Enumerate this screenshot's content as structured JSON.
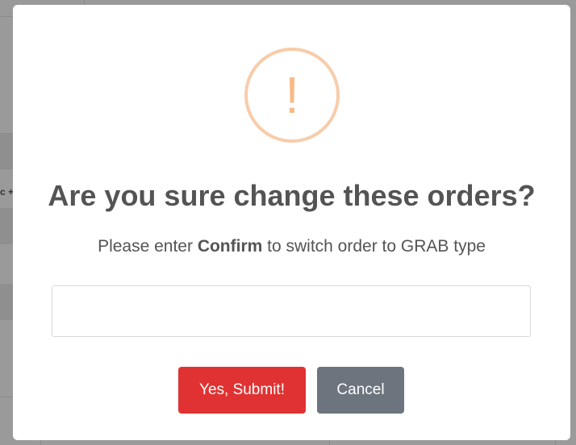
{
  "background": {
    "partial_text": "c +"
  },
  "dialog": {
    "icon": "warning-exclamation-icon",
    "icon_glyph": "!",
    "icon_color": "#f8bb86",
    "title": "Are you sure change these orders?",
    "message_prefix": "Please enter ",
    "message_keyword": "Confirm",
    "message_suffix": " to switch order to GRAB type",
    "input": {
      "value": "",
      "placeholder": ""
    },
    "buttons": {
      "submit_label": "Yes, Submit!",
      "submit_color": "#e03232",
      "cancel_label": "Cancel",
      "cancel_color": "#6c757d"
    }
  }
}
